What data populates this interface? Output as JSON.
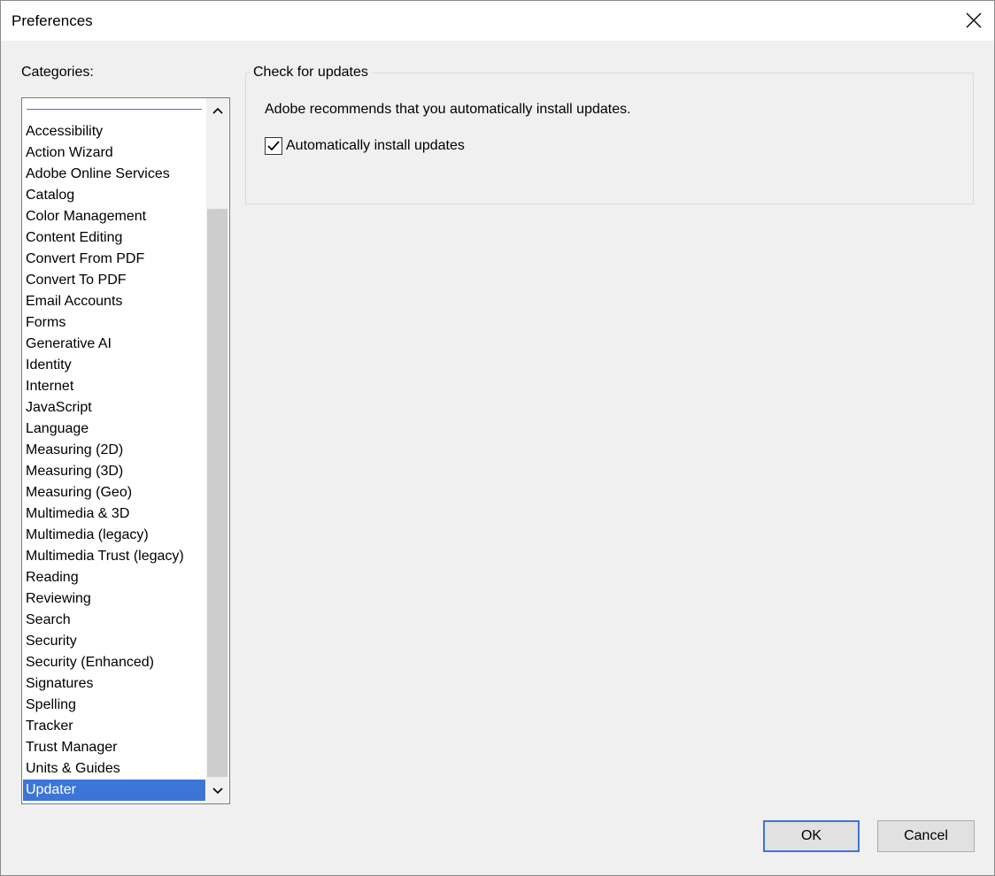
{
  "window": {
    "title": "Preferences"
  },
  "categories": {
    "label": "Categories:",
    "items": [
      "Accessibility",
      "Action Wizard",
      "Adobe Online Services",
      "Catalog",
      "Color Management",
      "Content Editing",
      "Convert From PDF",
      "Convert To PDF",
      "Email Accounts",
      "Forms",
      "Generative AI",
      "Identity",
      "Internet",
      "JavaScript",
      "Language",
      "Measuring (2D)",
      "Measuring (3D)",
      "Measuring (Geo)",
      "Multimedia & 3D",
      "Multimedia (legacy)",
      "Multimedia Trust (legacy)",
      "Reading",
      "Reviewing",
      "Search",
      "Security",
      "Security (Enhanced)",
      "Signatures",
      "Spelling",
      "Tracker",
      "Trust Manager",
      "Units & Guides",
      "Updater"
    ],
    "selected": "Updater"
  },
  "updates": {
    "group_title": "Check for updates",
    "recommend_text": "Adobe recommends that you automatically install updates.",
    "auto_install_label": "Automatically install updates",
    "auto_install_checked": true
  },
  "buttons": {
    "ok": "OK",
    "cancel": "Cancel"
  },
  "colors": {
    "selection": "#3c75d6",
    "background": "#f0f0f0"
  }
}
